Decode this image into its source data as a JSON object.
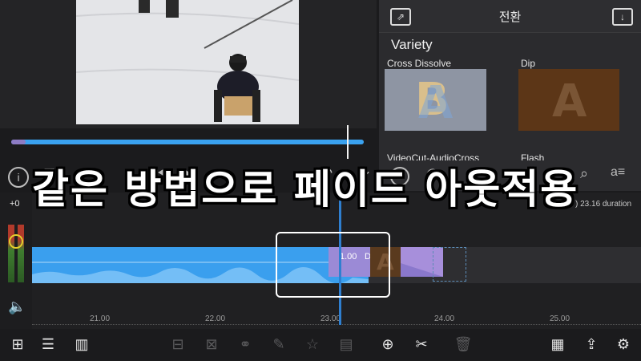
{
  "panel": {
    "title": "전환",
    "category": "Variety",
    "transitions": [
      {
        "label": "Cross Dissolve",
        "letter": "B"
      },
      {
        "label": "Dip",
        "letter": "A"
      },
      {
        "label": "VideoCut-AudioCross"
      },
      {
        "label": "Flash"
      }
    ]
  },
  "timeline": {
    "volume_db": "+0",
    "duration": ") 23.16 duration",
    "clip_duration": "1.00",
    "clip_transition": "Dip",
    "clip_letter": "A",
    "ruler": [
      "21.00",
      "22.00",
      "23.00",
      "24.00",
      "25.00"
    ]
  },
  "caption": "같은 방법으로 페이드 아웃적용",
  "colors": {
    "accent": "#3a9fee",
    "purple": "#9b8ad6",
    "dip_brown": "#5a3a1e"
  },
  "icons": {
    "info": "info-icon",
    "add": "add-icon",
    "export": "share-icon",
    "split": "scissors-icon",
    "settings": "gear-icon"
  }
}
